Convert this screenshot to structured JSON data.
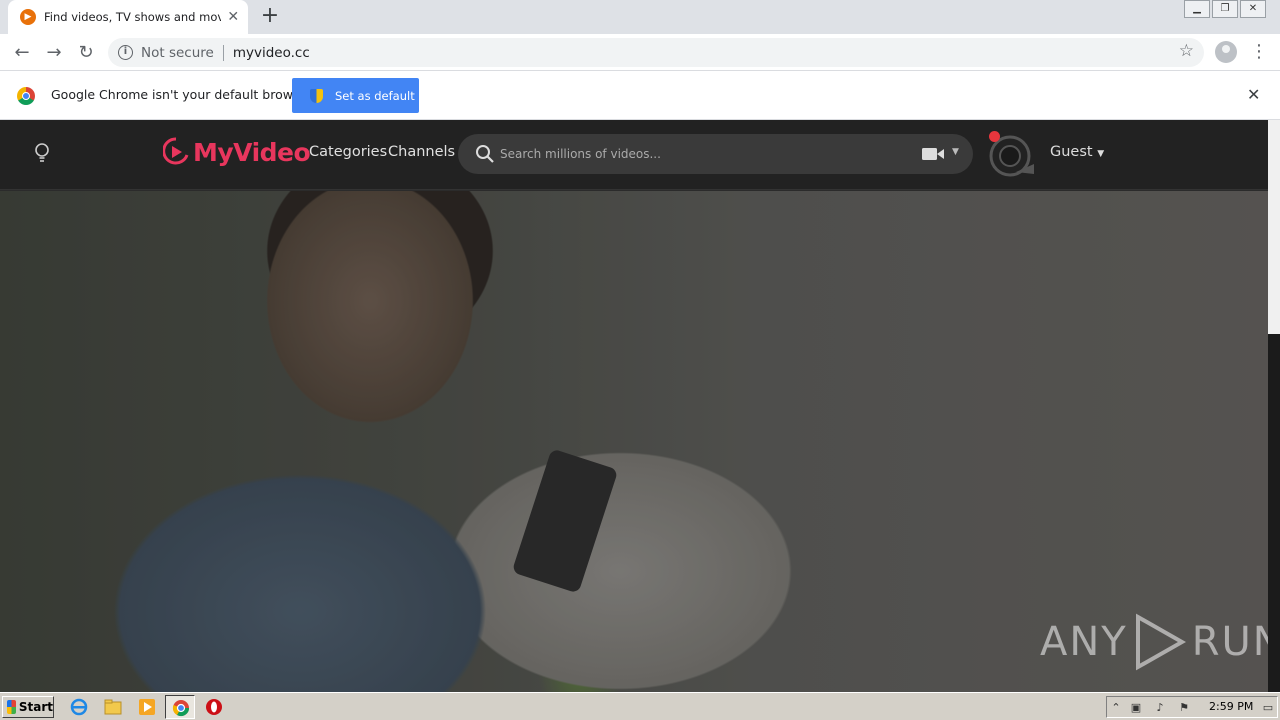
{
  "browser": {
    "tab_title": "Find videos, TV shows and movies in",
    "tab_favicon": "myvideo-favicon",
    "security_label": "Not secure",
    "url": "myvideo.cc"
  },
  "infobar": {
    "message": "Google Chrome isn't your default browser",
    "button_label": "Set as default"
  },
  "site": {
    "brand": "MyVideo",
    "brand_color": "#e8365d",
    "nav": [
      "Categories",
      "Channels"
    ],
    "search_placeholder": "Search millions of videos...",
    "user_label": "Guest"
  },
  "watermark": {
    "left": "ANY",
    "right": "RUN"
  },
  "taskbar": {
    "start_label": "Start",
    "clock": "2:59 PM"
  }
}
